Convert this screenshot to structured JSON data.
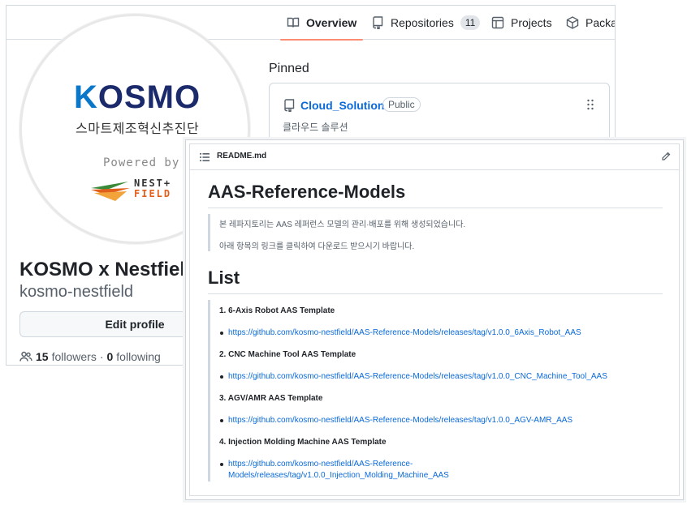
{
  "tabs": [
    {
      "label": "Overview",
      "icon": "book-icon",
      "active": true
    },
    {
      "label": "Repositories",
      "icon": "repo-icon",
      "count": "11"
    },
    {
      "label": "Projects",
      "icon": "table-icon"
    },
    {
      "label": "Packag",
      "icon": "package-icon"
    }
  ],
  "avatar": {
    "logo_k": "K",
    "logo_rest": "OSMO",
    "subtitle": "스마트제조혁신추진단",
    "powered_by": "Powered by",
    "nest": "NEST+",
    "field": "FIELD"
  },
  "profile": {
    "name": "KOSMO x Nestfield",
    "login": "kosmo-nestfield",
    "edit_label": "Edit profile",
    "followers_count": "15",
    "followers_label": "followers",
    "separator": "·",
    "following_count": "0",
    "following_label": "following"
  },
  "pinned": {
    "title": "Pinned",
    "repo_name": "Cloud_Solution",
    "visibility": "Public",
    "description": "클라우드 솔루션"
  },
  "readme": {
    "filename": "README.md",
    "title": "AAS-Reference-Models",
    "intro": [
      "본 레파지토리는 AAS 레퍼런스 모델의 관리·배포를 위해 생성되었습니다.",
      "아래 항목의 링크를 클릭하여 다운로드 받으시기 바랍니다."
    ],
    "list_title": "List",
    "items": [
      {
        "title": "1. 6-Axis Robot AAS Template",
        "link": "https://github.com/kosmo-nestfield/AAS-Reference-Models/releases/tag/v1.0.0_6Axis_Robot_AAS"
      },
      {
        "title": "2. CNC Machine Tool AAS Template",
        "link": "https://github.com/kosmo-nestfield/AAS-Reference-Models/releases/tag/v1.0.0_CNC_Machine_Tool_AAS"
      },
      {
        "title": "3. AGV/AMR AAS Template",
        "link": "https://github.com/kosmo-nestfield/AAS-Reference-Models/releases/tag/v1.0.0_AGV-AMR_AAS"
      },
      {
        "title": "4. Injection Molding Machine AAS Template",
        "link": "https://github.com/kosmo-nestfield/AAS-Reference-Models/releases/tag/v1.0.0_Injection_Molding_Machine_AAS",
        "link_line1": "https://github.com/kosmo-nestfield/AAS-Reference-",
        "link_line2": "Models/releases/tag/v1.0.0_Injection_Molding_Machine_AAS"
      }
    ]
  },
  "colors": {
    "link": "#0969da",
    "tab_underline": "#fd8c73",
    "kosmo_blue": "#0a77c9",
    "kosmo_navy": "#1b2a6b",
    "field_orange": "#e25f1b"
  }
}
